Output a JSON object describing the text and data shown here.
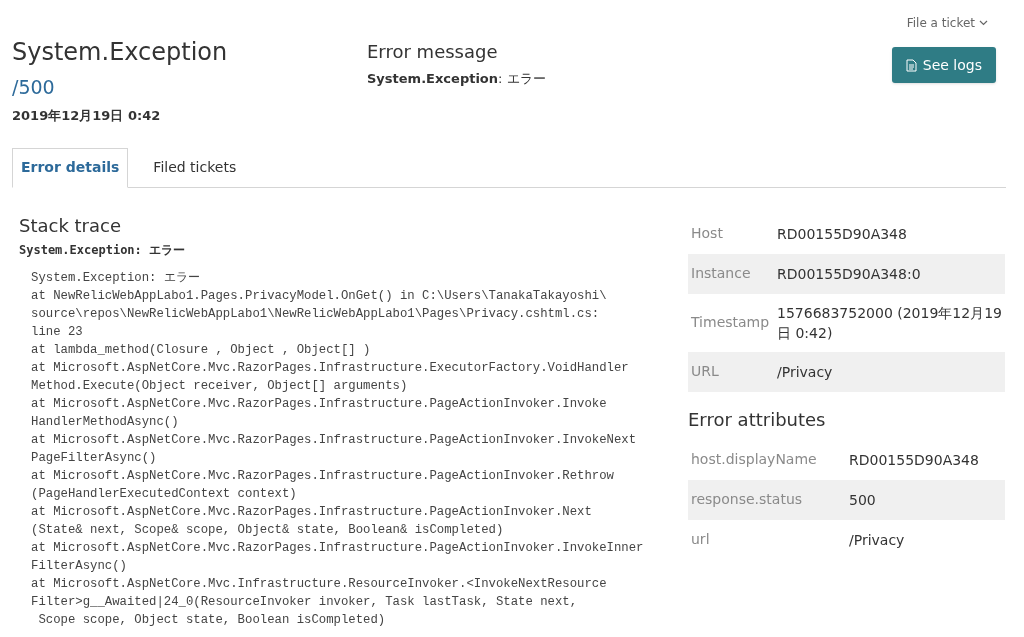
{
  "header": {
    "title": "System.Exception",
    "path": "/500",
    "date": "2019年12月19日 0:42"
  },
  "error_message": {
    "heading": "Error message",
    "text": "**System.Exception**: エラー"
  },
  "file_ticket": "File a ticket",
  "see_logs": "See logs",
  "tabs": [
    {
      "label": "Error details",
      "selected": true
    },
    {
      "label": "Filed tickets",
      "selected": false
    }
  ],
  "stack_trace": {
    "heading": "Stack trace",
    "summary": "System.Exception: エラー",
    "lines": [
      "System.Exception: エラー",
      "at NewRelicWebAppLabo1.Pages.PrivacyModel.OnGet() in C:\\Users\\TanakaTakayoshi\\",
      "source\\repos\\NewRelicWebAppLabo1\\NewRelicWebAppLabo1\\Pages\\Privacy.cshtml.cs:",
      "line 23",
      "at lambda_method(Closure , Object , Object[] )",
      "at Microsoft.AspNetCore.Mvc.RazorPages.Infrastructure.ExecutorFactory.VoidHandler",
      "Method.Execute(Object receiver, Object[] arguments)",
      "at Microsoft.AspNetCore.Mvc.RazorPages.Infrastructure.PageActionInvoker.Invoke",
      "HandlerMethodAsync()",
      "at Microsoft.AspNetCore.Mvc.RazorPages.Infrastructure.PageActionInvoker.InvokeNext",
      "PageFilterAsync()",
      "at Microsoft.AspNetCore.Mvc.RazorPages.Infrastructure.PageActionInvoker.Rethrow",
      "(PageHandlerExecutedContext context)",
      "at Microsoft.AspNetCore.Mvc.RazorPages.Infrastructure.PageActionInvoker.Next",
      "(State& next, Scope& scope, Object& state, Boolean& isCompleted)",
      "at Microsoft.AspNetCore.Mvc.RazorPages.Infrastructure.PageActionInvoker.InvokeInner",
      "FilterAsync()",
      "at Microsoft.AspNetCore.Mvc.Infrastructure.ResourceInvoker.<InvokeNextResource",
      "Filter>g__Awaited|24_0(ResourceInvoker invoker, Task lastTask, State next,",
      " Scope scope, Object state, Boolean isCompleted)"
    ]
  },
  "details": [
    {
      "label": "Host",
      "value": "RD00155D90A348"
    },
    {
      "label": "Instance",
      "value": "RD00155D90A348:0"
    },
    {
      "label": "Timestamp",
      "value": "1576683752000 (2019年12月19日 0:42)"
    },
    {
      "label": "URL",
      "value": "/Privacy"
    }
  ],
  "error_attributes": {
    "heading": "Error attributes",
    "rows": [
      {
        "label": "host.displayName",
        "value": "RD00155D90A348"
      },
      {
        "label": "response.status",
        "value": "500"
      },
      {
        "label": "url",
        "value": "/Privacy"
      }
    ]
  }
}
